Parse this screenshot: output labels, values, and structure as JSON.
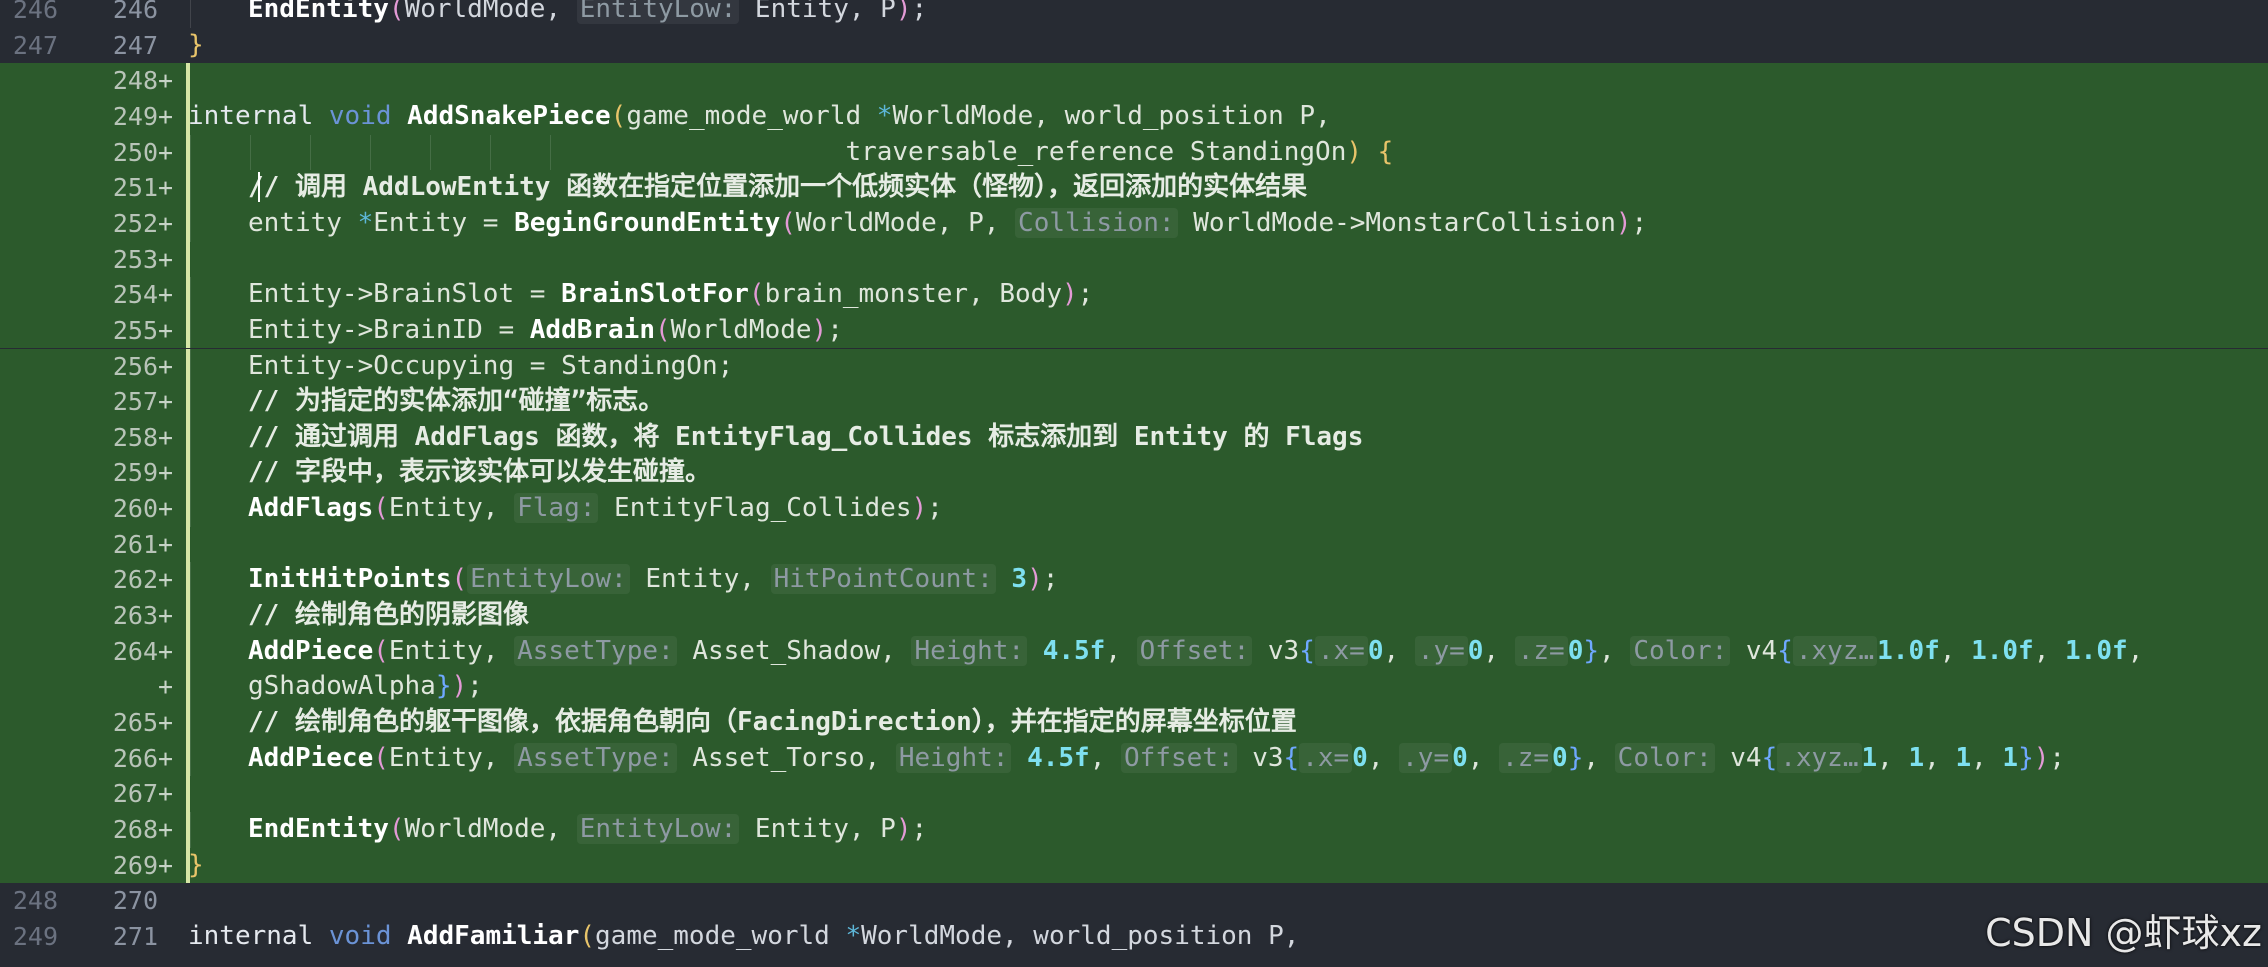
{
  "editor": {
    "lines": [
      {
        "old": "246",
        "new": "246",
        "mark": "",
        "added": false,
        "indent": 1,
        "tokens": [
          [
            "EndEntity",
            "fn"
          ],
          [
            "(",
            "paren"
          ],
          [
            "WorldMode, ",
            "id"
          ],
          [
            "EntityLow:",
            "hint"
          ],
          [
            " Entity, P",
            "id"
          ],
          [
            ")",
            "paren"
          ],
          [
            ";",
            "id"
          ]
        ]
      },
      {
        "old": "247",
        "new": "247",
        "mark": "",
        "added": false,
        "indent": 0,
        "tokens": [
          [
            "}",
            "paren2"
          ]
        ]
      },
      {
        "old": "",
        "new": "248",
        "mark": "+",
        "added": true,
        "indent": 0,
        "tokens": []
      },
      {
        "old": "",
        "new": "249",
        "mark": "+",
        "added": true,
        "indent": 0,
        "tokens": [
          [
            "internal ",
            "kw"
          ],
          [
            "void ",
            "kw2"
          ],
          [
            "AddSnakePiece",
            "fn"
          ],
          [
            "(",
            "paren2"
          ],
          [
            "game_mode_world ",
            "id"
          ],
          [
            "*",
            "star"
          ],
          [
            "WorldMode, world_position P,",
            "id"
          ]
        ]
      },
      {
        "old": "",
        "new": "250",
        "mark": "+",
        "added": true,
        "indent": 0,
        "guides": 7,
        "tokens": [
          [
            "                                          traversable_reference StandingOn",
            "id"
          ],
          [
            ")",
            "paren2"
          ],
          [
            " ",
            "id"
          ],
          [
            "{",
            "paren2"
          ]
        ]
      },
      {
        "old": "",
        "new": "251",
        "mark": "+",
        "added": true,
        "indent": 1,
        "caret": true,
        "tokens": [
          [
            "// 调用 AddLowEntity 函数在指定位置添加一个低频实体（怪物），返回添加的实体结果",
            "cm"
          ]
        ]
      },
      {
        "old": "",
        "new": "252",
        "mark": "+",
        "added": true,
        "indent": 1,
        "tokens": [
          [
            "entity ",
            "id"
          ],
          [
            "*",
            "star"
          ],
          [
            "Entity = ",
            "id"
          ],
          [
            "BeginGroundEntity",
            "fn"
          ],
          [
            "(",
            "paren"
          ],
          [
            "WorldMode, P, ",
            "id"
          ],
          [
            "Collision:",
            "hint"
          ],
          [
            " WorldMode->MonstarCollision",
            "id"
          ],
          [
            ")",
            "paren"
          ],
          [
            ";",
            "id"
          ]
        ]
      },
      {
        "old": "",
        "new": "253",
        "mark": "+",
        "added": true,
        "indent": 0,
        "tokens": []
      },
      {
        "old": "",
        "new": "254",
        "mark": "+",
        "added": true,
        "indent": 1,
        "tokens": [
          [
            "Entity->BrainSlot = ",
            "id"
          ],
          [
            "BrainSlotFor",
            "fn"
          ],
          [
            "(",
            "paren"
          ],
          [
            "brain_monster, Body",
            "id"
          ],
          [
            ")",
            "paren"
          ],
          [
            ";",
            "id"
          ]
        ]
      },
      {
        "old": "",
        "new": "255",
        "mark": "+",
        "added": true,
        "indent": 1,
        "tokens": [
          [
            "Entity->BrainID = ",
            "id"
          ],
          [
            "AddBrain",
            "fn"
          ],
          [
            "(",
            "paren"
          ],
          [
            "WorldMode",
            "id"
          ],
          [
            ")",
            "paren"
          ],
          [
            ";",
            "id"
          ]
        ]
      },
      {
        "old": "",
        "new": "256",
        "mark": "+",
        "added": true,
        "indent": 1,
        "tokens": [
          [
            "Entity->Occupying = StandingOn;",
            "id"
          ]
        ]
      },
      {
        "old": "",
        "new": "257",
        "mark": "+",
        "added": true,
        "indent": 1,
        "tokens": [
          [
            "// 为指定的实体添加“碰撞”标志。",
            "cm"
          ]
        ]
      },
      {
        "old": "",
        "new": "258",
        "mark": "+",
        "added": true,
        "indent": 1,
        "tokens": [
          [
            "// 通过调用 AddFlags 函数，将 EntityFlag_Collides 标志添加到 Entity 的 Flags",
            "cm"
          ]
        ]
      },
      {
        "old": "",
        "new": "259",
        "mark": "+",
        "added": true,
        "indent": 1,
        "tokens": [
          [
            "// 字段中，表示该实体可以发生碰撞。",
            "cm"
          ]
        ]
      },
      {
        "old": "",
        "new": "260",
        "mark": "+",
        "added": true,
        "indent": 1,
        "tokens": [
          [
            "AddFlags",
            "fn"
          ],
          [
            "(",
            "paren"
          ],
          [
            "Entity, ",
            "id"
          ],
          [
            "Flag:",
            "hint"
          ],
          [
            " EntityFlag_Collides",
            "id"
          ],
          [
            ")",
            "paren"
          ],
          [
            ";",
            "id"
          ]
        ]
      },
      {
        "old": "",
        "new": "261",
        "mark": "+",
        "added": true,
        "indent": 0,
        "tokens": []
      },
      {
        "old": "",
        "new": "262",
        "mark": "+",
        "added": true,
        "indent": 1,
        "tokens": [
          [
            "InitHitPoints",
            "fn"
          ],
          [
            "(",
            "paren"
          ],
          [
            "EntityLow:",
            "hint"
          ],
          [
            " Entity, ",
            "id"
          ],
          [
            "HitPointCount:",
            "hint"
          ],
          [
            " ",
            "id"
          ],
          [
            "3",
            "num"
          ],
          [
            ")",
            "paren"
          ],
          [
            ";",
            "id"
          ]
        ]
      },
      {
        "old": "",
        "new": "263",
        "mark": "+",
        "added": true,
        "indent": 1,
        "tokens": [
          [
            "// 绘制角色的阴影图像",
            "cm"
          ]
        ]
      },
      {
        "old": "",
        "new": "264",
        "mark": "+",
        "added": true,
        "indent": 1,
        "tokens": [
          [
            "AddPiece",
            "fn"
          ],
          [
            "(",
            "paren"
          ],
          [
            "Entity, ",
            "id"
          ],
          [
            "AssetType:",
            "hint"
          ],
          [
            " Asset_Shadow, ",
            "id"
          ],
          [
            "Height:",
            "hint"
          ],
          [
            " ",
            "id"
          ],
          [
            "4.5f",
            "num"
          ],
          [
            ", ",
            "id"
          ],
          [
            "Offset:",
            "hint"
          ],
          [
            " v3",
            "id"
          ],
          [
            "{",
            "paren3"
          ],
          [
            ".x=",
            "hint"
          ],
          [
            "0",
            "num"
          ],
          [
            ", ",
            "id"
          ],
          [
            ".y=",
            "hint"
          ],
          [
            "0",
            "num"
          ],
          [
            ", ",
            "id"
          ],
          [
            ".z=",
            "hint"
          ],
          [
            "0",
            "num"
          ],
          [
            "}",
            "paren3"
          ],
          [
            ", ",
            "id"
          ],
          [
            "Color:",
            "hint"
          ],
          [
            " v4",
            "id"
          ],
          [
            "{",
            "paren3"
          ],
          [
            ".xyz…",
            "hint"
          ],
          [
            "1.0f",
            "num"
          ],
          [
            ", ",
            "id"
          ],
          [
            "1.0f",
            "num"
          ],
          [
            ", ",
            "id"
          ],
          [
            "1.0f",
            "num"
          ],
          [
            ",",
            "id"
          ]
        ]
      },
      {
        "old": "",
        "new": "",
        "mark": "+",
        "added": true,
        "indent": 1,
        "tokens": [
          [
            "gShadowAlpha",
            "id"
          ],
          [
            "}",
            "paren3"
          ],
          [
            ")",
            "paren"
          ],
          [
            ";",
            "id"
          ]
        ]
      },
      {
        "old": "",
        "new": "265",
        "mark": "+",
        "added": true,
        "indent": 1,
        "tokens": [
          [
            "// 绘制角色的躯干图像，依据角色朝向（FacingDirection），并在指定的屏幕坐标位置",
            "cm"
          ]
        ]
      },
      {
        "old": "",
        "new": "266",
        "mark": "+",
        "added": true,
        "indent": 1,
        "tokens": [
          [
            "AddPiece",
            "fn"
          ],
          [
            "(",
            "paren"
          ],
          [
            "Entity, ",
            "id"
          ],
          [
            "AssetType:",
            "hint"
          ],
          [
            " Asset_Torso, ",
            "id"
          ],
          [
            "Height:",
            "hint"
          ],
          [
            " ",
            "id"
          ],
          [
            "4.5f",
            "num"
          ],
          [
            ", ",
            "id"
          ],
          [
            "Offset:",
            "hint"
          ],
          [
            " v3",
            "id"
          ],
          [
            "{",
            "paren3"
          ],
          [
            ".x=",
            "hint"
          ],
          [
            "0",
            "num"
          ],
          [
            ", ",
            "id"
          ],
          [
            ".y=",
            "hint"
          ],
          [
            "0",
            "num"
          ],
          [
            ", ",
            "id"
          ],
          [
            ".z=",
            "hint"
          ],
          [
            "0",
            "num"
          ],
          [
            "}",
            "paren3"
          ],
          [
            ", ",
            "id"
          ],
          [
            "Color:",
            "hint"
          ],
          [
            " v4",
            "id"
          ],
          [
            "{",
            "paren3"
          ],
          [
            ".xyz…",
            "hint"
          ],
          [
            "1",
            "num"
          ],
          [
            ", ",
            "id"
          ],
          [
            "1",
            "num"
          ],
          [
            ", ",
            "id"
          ],
          [
            "1",
            "num"
          ],
          [
            ", ",
            "id"
          ],
          [
            "1",
            "num"
          ],
          [
            "}",
            "paren3"
          ],
          [
            ")",
            "paren"
          ],
          [
            ";",
            "id"
          ]
        ]
      },
      {
        "old": "",
        "new": "267",
        "mark": "+",
        "added": true,
        "indent": 0,
        "tokens": []
      },
      {
        "old": "",
        "new": "268",
        "mark": "+",
        "added": true,
        "indent": 1,
        "tokens": [
          [
            "EndEntity",
            "fn"
          ],
          [
            "(",
            "paren"
          ],
          [
            "WorldMode, ",
            "id"
          ],
          [
            "EntityLow:",
            "hint"
          ],
          [
            " Entity, P",
            "id"
          ],
          [
            ")",
            "paren"
          ],
          [
            ";",
            "id"
          ]
        ]
      },
      {
        "old": "",
        "new": "269",
        "mark": "+",
        "added": true,
        "indent": 0,
        "tokens": [
          [
            "}",
            "paren2"
          ]
        ]
      },
      {
        "old": "248",
        "new": "270",
        "mark": "",
        "added": false,
        "indent": 0,
        "tokens": []
      },
      {
        "old": "249",
        "new": "271",
        "mark": "",
        "added": false,
        "indent": 0,
        "tokens": [
          [
            "internal ",
            "kw"
          ],
          [
            "void ",
            "kw2"
          ],
          [
            "AddFamiliar",
            "fn"
          ],
          [
            "(",
            "paren2"
          ],
          [
            "game_mode_world ",
            "id"
          ],
          [
            "*",
            "star"
          ],
          [
            "WorldMode, world_position P,",
            "id"
          ]
        ]
      }
    ]
  },
  "watermark": "CSDN @虾球xz",
  "colors": {
    "background": "#272b33",
    "added_line": "#2c5a2c",
    "change_bar": "#d6e6a6",
    "number": "#7ee0f0",
    "paren": "#e39ad6",
    "brace": "#e8c46a"
  }
}
